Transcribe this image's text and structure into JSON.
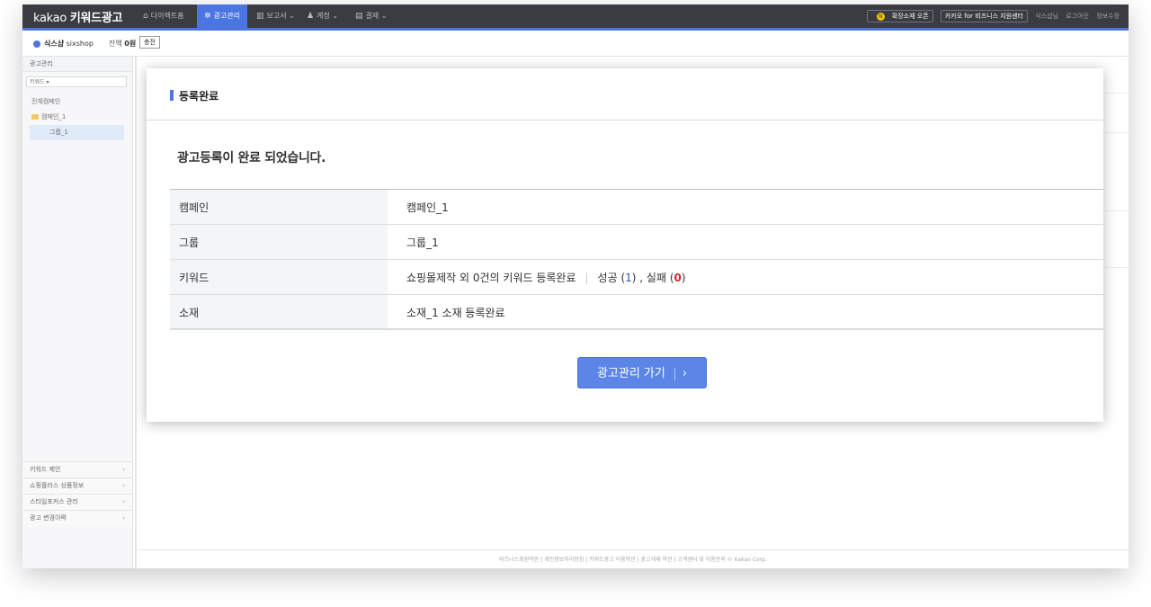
{
  "app": {
    "logo_brand": "kakao",
    "logo_product": "키워드광고"
  },
  "nav": {
    "items": [
      {
        "icon": "home-icon",
        "label": "다이렉트홈"
      },
      {
        "icon": "gear-icon",
        "label": "광고관리"
      },
      {
        "icon": "chart-icon",
        "label": "보고서"
      },
      {
        "icon": "user-icon",
        "label": "계정"
      },
      {
        "icon": "card-icon",
        "label": "결제"
      }
    ],
    "right": {
      "badge": "확장소재 오픈",
      "support": "카카오 for 비즈니스 지원센터",
      "user": "식스샵님",
      "logout": "로그아웃",
      "edit": "정보수정"
    }
  },
  "subbar": {
    "account_name": "식스샵",
    "account_id": "sixshop",
    "balance_label": "잔액",
    "balance_value": "0원",
    "charge": "충전"
  },
  "sidebar": {
    "header": "광고관리",
    "search_scope": "키워드 ▾",
    "tree": {
      "all": "전체캠페인",
      "campaign": "캠페인_1",
      "group": "그룹_1"
    },
    "menu": [
      {
        "label": "키워드 제안"
      },
      {
        "label": "쇼핑플러스 상품정보"
      },
      {
        "label": "스타일포커스 관리"
      },
      {
        "label": "광고 변경이력"
      }
    ]
  },
  "modal": {
    "title": "등록완료",
    "message": "광고등록이 완료 되었습니다.",
    "rows": [
      {
        "key": "캠페인",
        "value": "캠페인_1"
      },
      {
        "key": "그룹",
        "value": "그룹_1"
      },
      {
        "key": "키워드",
        "value": "쇼핑몰제작 외 0건의 키워드 등록완료",
        "success_label": "성공",
        "success_count": "1",
        "fail_label": "실패",
        "fail_count": "0"
      },
      {
        "key": "소재",
        "value": "소재_1 소재 등록완료"
      }
    ],
    "button": "광고관리 가기"
  },
  "footer": {
    "text": "비즈니스회원약관 | 개인정보처리방침 | 키워드광고 이용약관 | 광고게재 약관 | 고객센터 및 이용문의 © Kakao Corp."
  },
  "colors": {
    "accent": "#4b75e0",
    "nav_bg": "#3a3c42",
    "fail": "#d8262c"
  }
}
